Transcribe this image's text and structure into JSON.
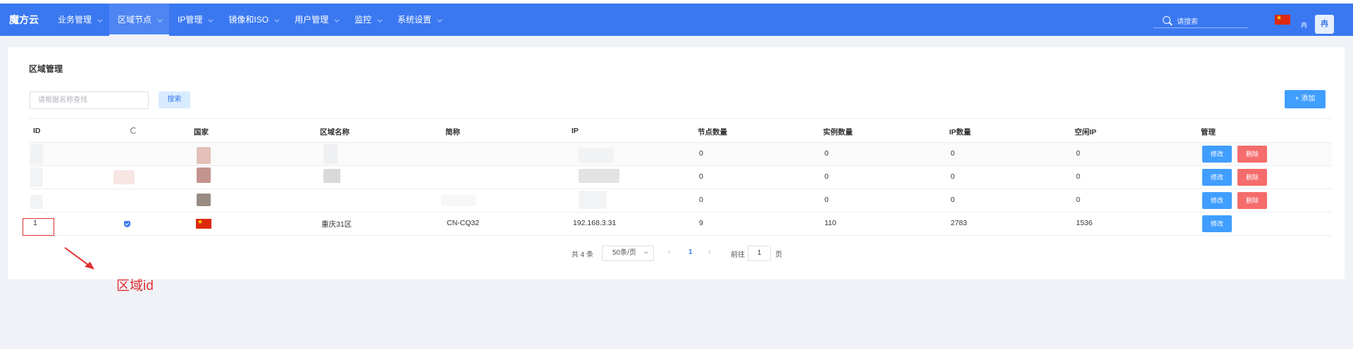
{
  "nav": {
    "logo": "魔方云",
    "items": [
      "业务管理",
      "区域节点",
      "IP管理",
      "镜像和ISO",
      "用户管理",
      "监控",
      "系统设置"
    ],
    "search_placeholder": "请搜索",
    "lang": "冉",
    "avatar": "冉",
    "accent": "#3a78f2"
  },
  "page": {
    "title": "区域管理",
    "search_placeholder": "请根据名称查找",
    "search_button": "搜索",
    "add_button": "+ 添加"
  },
  "table": {
    "headers": [
      "ID",
      "",
      "国家",
      "区域名称",
      "简称",
      "IP",
      "节点数量",
      "实例数量",
      "IP数量",
      "空闲IP",
      "管理"
    ],
    "rows": [
      {
        "id": "",
        "name": "",
        "short": "",
        "ip": "",
        "nodes": "0",
        "instances": "0",
        "ips": "0",
        "free": "0",
        "edit": "修改",
        "delete": "删除"
      },
      {
        "id": "",
        "name": "",
        "short": "",
        "ip": "",
        "nodes": "0",
        "instances": "0",
        "ips": "0",
        "free": "0",
        "edit": "修改",
        "delete": "删除"
      },
      {
        "id": "",
        "name": "",
        "short": "",
        "ip": "",
        "nodes": "0",
        "instances": "0",
        "ips": "0",
        "free": "0",
        "edit": "修改",
        "delete": "删除"
      },
      {
        "id": "1",
        "name": "重庆31区",
        "short": "CN-CQ32",
        "ip": "192.168.3.31",
        "nodes": "9",
        "instances": "110",
        "ips": "2783",
        "free": "1536",
        "edit": "修改"
      }
    ]
  },
  "pagination": {
    "total": "共 4 条",
    "page_size": "50条/页",
    "prev": "‹",
    "current": "1",
    "next": "›",
    "goto_label": "前往",
    "goto_value": "1",
    "page_unit": "页"
  },
  "annotation": {
    "label": "区域id",
    "color": "#e03131"
  }
}
